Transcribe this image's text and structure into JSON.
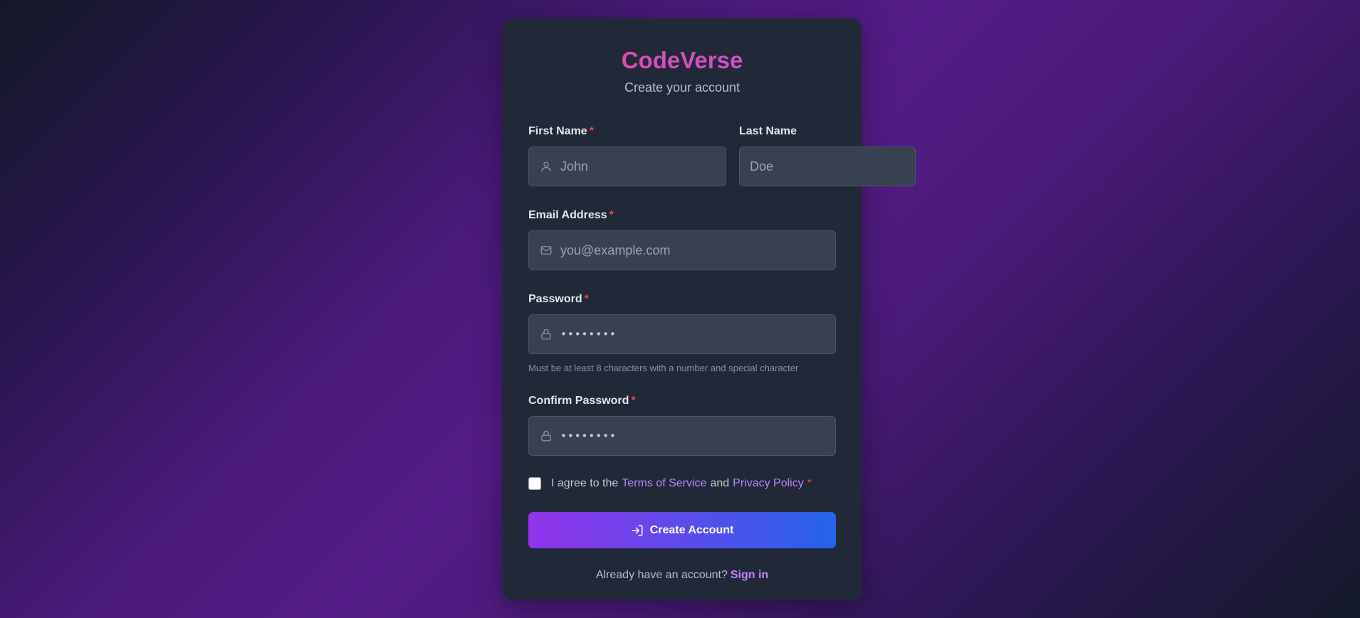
{
  "brand": {
    "name": "CodeVerse",
    "subtitle": "Create your account"
  },
  "form": {
    "first_name": {
      "label": "First Name",
      "required_mark": "*",
      "placeholder": "John",
      "icon": "user-icon"
    },
    "last_name": {
      "label": "Last Name",
      "placeholder": "Doe"
    },
    "email": {
      "label": "Email Address",
      "required_mark": "*",
      "placeholder": "you@example.com",
      "icon": "mail-icon"
    },
    "password": {
      "label": "Password",
      "required_mark": "*",
      "value": "••••••••",
      "icon": "lock-icon",
      "hint": "Must be at least 8 characters with a number and special character"
    },
    "confirm_password": {
      "label": "Confirm Password",
      "required_mark": "*",
      "value": "••••••••",
      "icon": "lock-icon"
    },
    "agree": {
      "prefix": "I agree to the",
      "terms_link": "Terms of Service",
      "and": "and",
      "privacy_link": "Privacy Policy",
      "required_mark": "*",
      "checked": false
    },
    "submit": {
      "label": "Create Account",
      "icon": "login-icon"
    }
  },
  "footer": {
    "text": "Already have an account?",
    "link": "Sign in"
  },
  "colors": {
    "accent_purple": "#9333ea",
    "accent_blue": "#2563eb",
    "link": "#c084fc",
    "required": "#ef4444",
    "brand_pink": "#ec4899"
  }
}
